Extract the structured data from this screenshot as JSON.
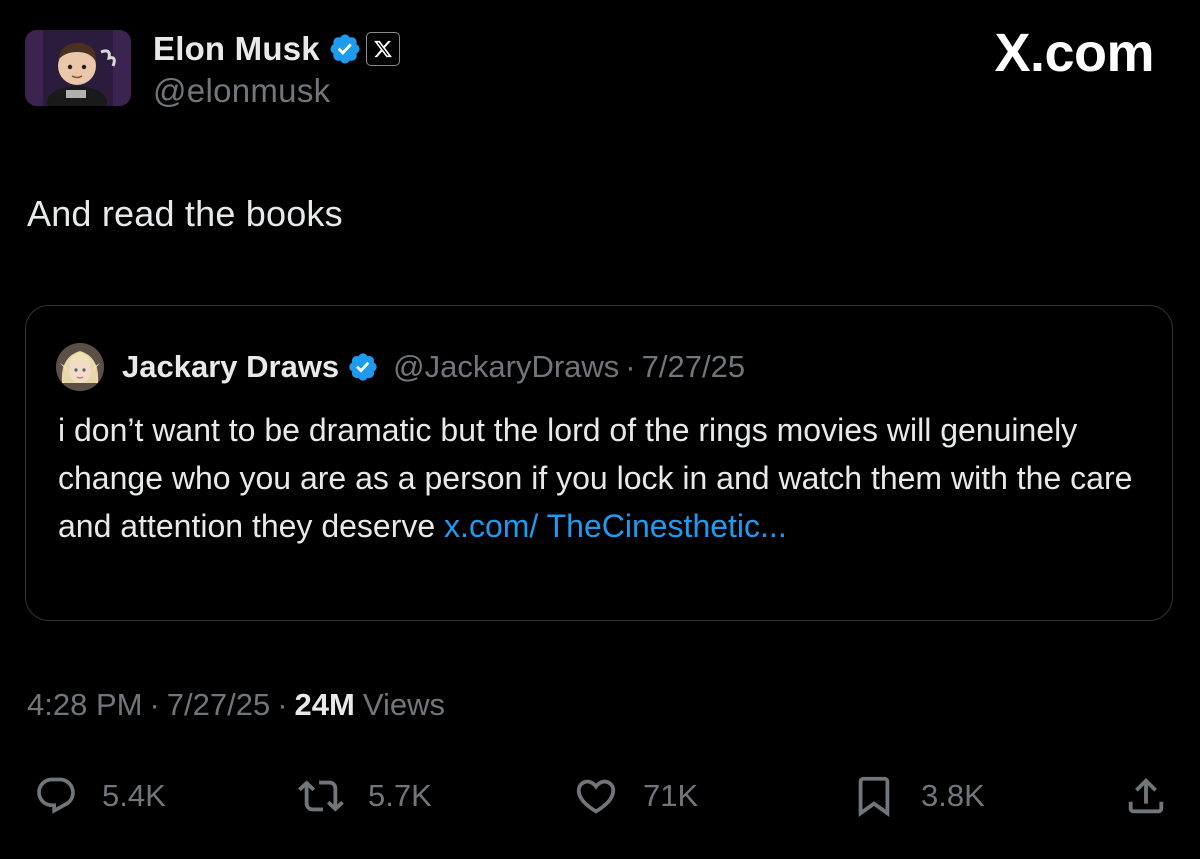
{
  "watermark": "X.com",
  "author": {
    "display_name": "Elon Musk",
    "handle": "@elonmusk",
    "verified": true,
    "affiliate_icon": "x-logo-icon"
  },
  "tweet": {
    "text": "And read the books"
  },
  "quote": {
    "display_name": "Jackary Draws",
    "handle": "@JackaryDraws",
    "separator": "·",
    "date": "7/27/25",
    "body_text": "i don’t want to be dramatic but the lord of the rings movies will genuinely change who you are as a person if you lock in and watch them with the care and attention they deserve ",
    "link_text": "x.com/ TheCinesthetic..."
  },
  "meta": {
    "time": "4:28 PM",
    "separator": "·",
    "date": "7/27/25",
    "views_count": "24M",
    "views_label": "Views"
  },
  "actions": {
    "reply_count": "5.4K",
    "retweet_count": "5.7K",
    "like_count": "71K",
    "bookmark_count": "3.8K"
  },
  "colors": {
    "background": "#000000",
    "primary_text": "#e7e9ea",
    "secondary_text": "#71767b",
    "link": "#1d9bf0",
    "verified": "#1d9bf0",
    "border": "#2f3336"
  }
}
